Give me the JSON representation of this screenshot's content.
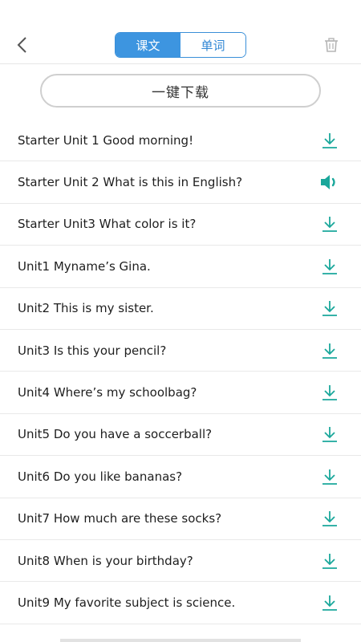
{
  "header": {
    "back_icon": "chevron-left-icon",
    "tabs": [
      {
        "label": "课文",
        "active": true
      },
      {
        "label": "单词",
        "active": false
      }
    ],
    "trash_icon": "trash-icon"
  },
  "download_all": {
    "label": "一键下载"
  },
  "colors": {
    "accent": "#3d95e0",
    "teal": "#1aa79b",
    "divider": "#e9e9e9"
  },
  "lessons": [
    {
      "title": "Starter Unit 1 Good morning!",
      "status": "download",
      "icon": "download-icon"
    },
    {
      "title": "Starter Unit 2 What is this in English?",
      "status": "playing",
      "icon": "speaker-icon"
    },
    {
      "title": "Starter Unit3 What color is it?",
      "status": "download",
      "icon": "download-icon"
    },
    {
      "title": "Unit1 Myname’s Gina.",
      "status": "download",
      "icon": "download-icon"
    },
    {
      "title": "Unit2 This is my sister.",
      "status": "download",
      "icon": "download-icon"
    },
    {
      "title": "Unit3 Is this your pencil?",
      "status": "download",
      "icon": "download-icon"
    },
    {
      "title": "Unit4 Where’s my schoolbag?",
      "status": "download",
      "icon": "download-icon"
    },
    {
      "title": "Unit5 Do you have a soccerball?",
      "status": "download",
      "icon": "download-icon"
    },
    {
      "title": "Unit6 Do you like bananas?",
      "status": "download",
      "icon": "download-icon"
    },
    {
      "title": "Unit7 How much are these socks?",
      "status": "download",
      "icon": "download-icon"
    },
    {
      "title": "Unit8 When is your birthday?",
      "status": "download",
      "icon": "download-icon"
    },
    {
      "title": "Unit9 My favorite subject is science.",
      "status": "download",
      "icon": "download-icon"
    }
  ]
}
